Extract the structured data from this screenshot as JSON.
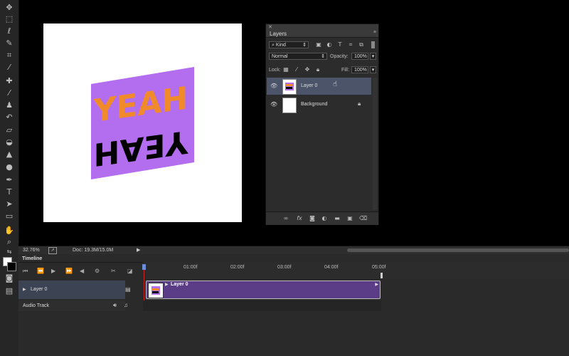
{
  "canvas": {
    "art_top": "YEAH",
    "art_bottom": "YEAH",
    "art_panel_color": "#b36ef0",
    "art_top_color": "#f08a2a",
    "art_bottom_color": "#000000"
  },
  "layers_panel": {
    "title": "Layers",
    "filter_label": "Kind",
    "blend_mode": "Normal",
    "opacity_label": "Opacity:",
    "opacity_value": "100%",
    "lock_label": "Lock:",
    "fill_label": "Fill:",
    "fill_value": "100%",
    "layers": [
      {
        "name": "Layer 0",
        "selected": true
      },
      {
        "name": "Background",
        "selected": false
      }
    ],
    "footer_icons": [
      "link-icon",
      "fx-icon",
      "mask-icon",
      "adjustment-icon",
      "folder-icon",
      "new-layer-icon",
      "trash-icon"
    ],
    "fx_label": "fx"
  },
  "status_bar": {
    "zoom": "32.76%",
    "doc": "Doc: 19.3M/15.0M"
  },
  "timeline": {
    "title": "Timeline",
    "ticks": [
      "01:00f",
      "02:00f",
      "03:00f",
      "04:00f",
      "05:00f"
    ],
    "tracks": [
      {
        "name": "Layer 0"
      },
      {
        "name": "Audio Track"
      }
    ],
    "clip_label": "Layer 0",
    "clip_color": "#5a3d86"
  },
  "colors": {
    "accent_selected": "#4b5468",
    "playhead": "#c22"
  }
}
